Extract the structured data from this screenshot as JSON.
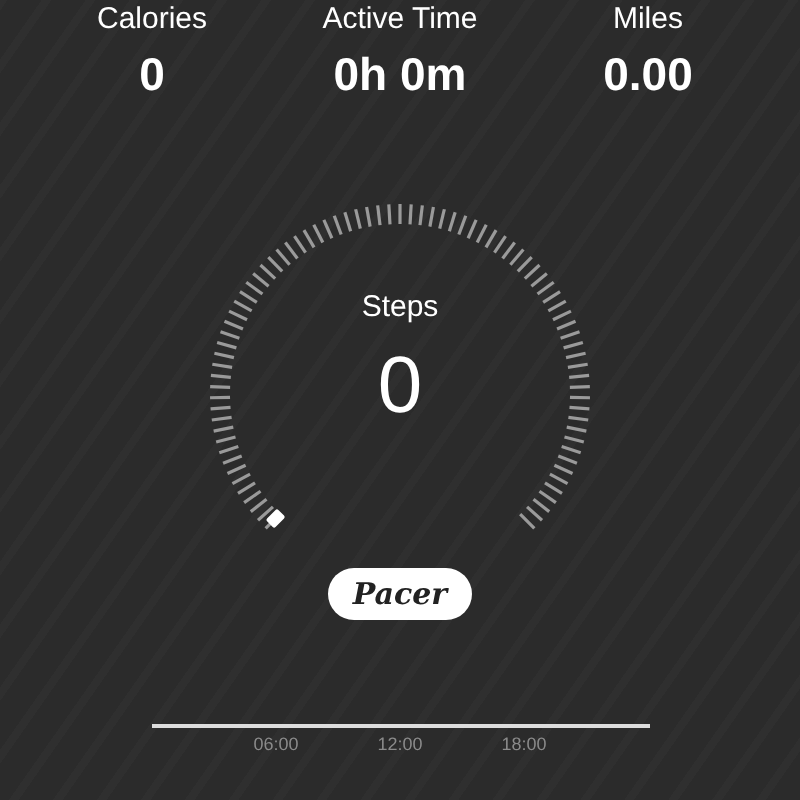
{
  "stats": [
    {
      "label": "Calories",
      "value": "0"
    },
    {
      "label": "Active Time",
      "value": "0h 0m"
    },
    {
      "label": "Miles",
      "value": "0.00"
    }
  ],
  "gauge": {
    "label": "Steps",
    "value": "0"
  },
  "brand_button": {
    "label": "Pacer"
  },
  "timeline": {
    "ticks": [
      "06:00",
      "12:00",
      "18:00"
    ]
  }
}
